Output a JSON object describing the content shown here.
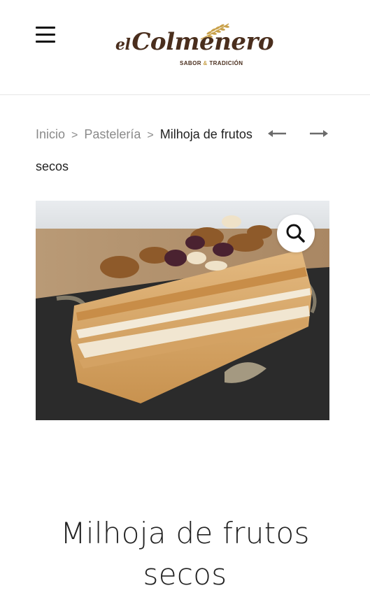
{
  "header": {
    "logo": {
      "prefix": "el",
      "name": "Colmenero",
      "tagline_left": "SABOR",
      "tagline_amp": "&",
      "tagline_right": "TRADICIÓN",
      "brand_color": "#4a2e1d",
      "accent_color": "#c9a14a"
    },
    "menu_icon": "hamburger-menu-icon"
  },
  "breadcrumb": {
    "items": [
      {
        "label": "Inicio"
      },
      {
        "label": "Pastelería"
      }
    ],
    "separator": ">",
    "current": "Milhoja de frutos secos"
  },
  "product_nav": {
    "prev_icon": "arrow-left-icon",
    "next_icon": "arrow-right-icon"
  },
  "product": {
    "image_icon": "zoom-search-icon",
    "title": "Milhoja de frutos secos"
  }
}
